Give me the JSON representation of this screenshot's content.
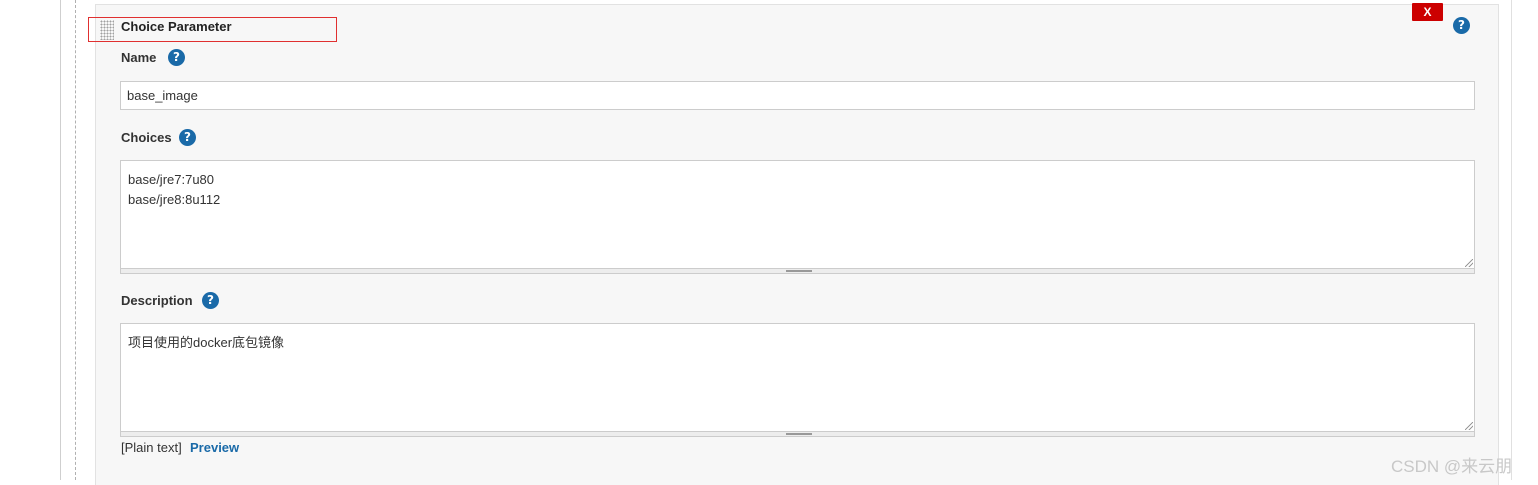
{
  "parameter": {
    "title": "Choice Parameter",
    "delete_label": "X",
    "help_glyph": "?"
  },
  "fields": {
    "name_label": "Name",
    "name_value": "base_image",
    "choices_label": "Choices",
    "choices_value": "base/jre7:7u80\nbase/jre8:8u112",
    "description_label": "Description",
    "description_value": "项目使用的docker底包镜像"
  },
  "footer": {
    "plain_text": "[Plain text]",
    "preview_label": "Preview"
  },
  "watermark": "CSDN @来云朋",
  "colors": {
    "help_icon": "#1a6aa8",
    "delete_button": "#cc0000",
    "highlight_box": "#e03030",
    "link": "#1a6aa8"
  },
  "icons": {
    "help": "help-icon",
    "drag": "drag-handle-icon",
    "resize": "resize-corner-icon"
  }
}
